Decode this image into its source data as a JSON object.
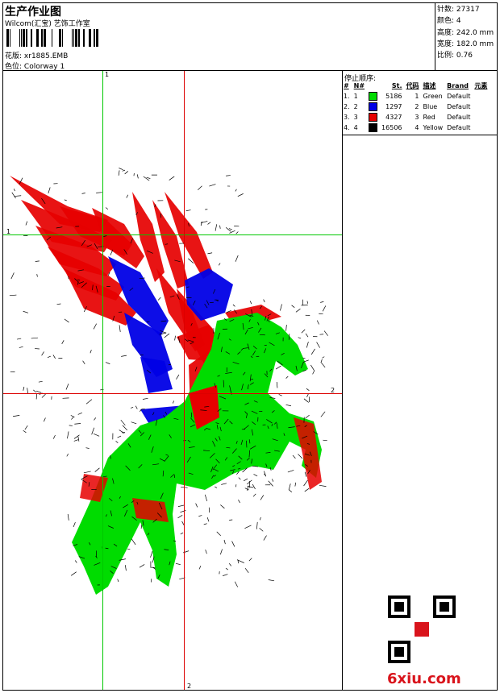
{
  "header": {
    "title": "生产作业图",
    "company": "Wilcom(汇宝) 艺饰工作室",
    "design_label": "花版:",
    "design_value": "xr1885.EMB",
    "colorway_label": "色位:",
    "colorway_value": "Colorway 1"
  },
  "specs": {
    "stitches_label": "针数:",
    "stitches": "27317",
    "colors_label": "颜色:",
    "colors": "4",
    "height_label": "高度:",
    "height": "242.0 mm",
    "width_label": "宽度:",
    "width": "182.0 mm",
    "scale_label": "比例:",
    "scale": "0.76"
  },
  "stop_sequence": {
    "title": "停止顺序:",
    "headers": [
      "#",
      "N#",
      "St.",
      "代码",
      "描述",
      "Brand",
      "元素"
    ],
    "rows": [
      {
        "num": "1.",
        "n": "1",
        "color": "#00dc00",
        "st": "5186",
        "code": "1",
        "desc": "Green",
        "brand": "Default"
      },
      {
        "num": "2.",
        "n": "2",
        "color": "#0000e6",
        "st": "1297",
        "code": "2",
        "desc": "Blue",
        "brand": "Default"
      },
      {
        "num": "3.",
        "n": "3",
        "color": "#e60000",
        "st": "4327",
        "code": "3",
        "desc": "Red",
        "brand": "Default"
      },
      {
        "num": "4.",
        "n": "4",
        "color": "#000000",
        "st": "16506",
        "code": "4",
        "desc": "Yellow",
        "brand": "Default"
      }
    ]
  },
  "guides": {
    "v_green": "1",
    "h_green": "1",
    "h_red": "2",
    "v_red": "2"
  },
  "watermark": "6xiu.com",
  "colors": {
    "green": "#00dc00",
    "blue": "#0000e6",
    "red": "#e60000",
    "guide_green": "#00c800",
    "guide_red": "#dc0000"
  }
}
